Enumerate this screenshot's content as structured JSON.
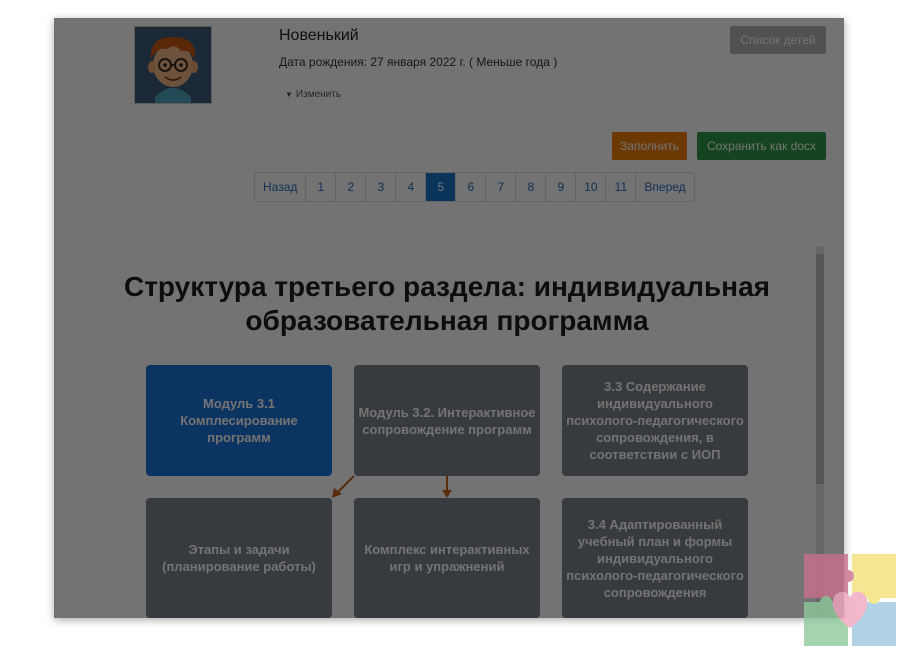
{
  "child": {
    "name": "Новенький",
    "birth_line": "Дата рождения: 27 января 2022 г. ( Меньше года )",
    "edit_label": "Изменить"
  },
  "toolbar": {
    "children_list_label": "Список детей",
    "fill_label": "Заполнить",
    "save_docx_label": "Сохранить как docx"
  },
  "pagination": {
    "prev": "Назад",
    "pages": [
      "1",
      "2",
      "3",
      "4",
      "5",
      "6",
      "7",
      "8",
      "9",
      "10",
      "11"
    ],
    "active": "5",
    "next": "Вперед"
  },
  "slide": {
    "title_line1": "Структура третьего раздела: индивидуальная",
    "title_line2": "образовательная программа",
    "boxes": [
      {
        "text": "Модуль 3.1 Комплесирование программ",
        "color": "#1b73d9"
      },
      {
        "text": "Модуль 3.2. Интерактивное сопровождение программ",
        "color": "#7a8089"
      },
      {
        "text": "3.3 Содержание индивидуального психолого-педагогического сопровождения, в соответствии с ИОП",
        "color": "#7a8089"
      },
      {
        "text": "Этапы и задачи (планирование работы)",
        "color": "#7a8089"
      },
      {
        "text": "Комплекс интерактивных игр и упражнений",
        "color": "#7a8089"
      },
      {
        "text": "3.4 Адаптированный учебный план и формы индивидуального психолого-педагогического сопровождения",
        "color": "#7a8089"
      }
    ],
    "arrow_color": "#c8611b"
  },
  "icons": {
    "avatar": "cartoon-boy-avatar",
    "edit_caret": "caret-down-icon",
    "watermark": "puzzle-heart-logo"
  }
}
